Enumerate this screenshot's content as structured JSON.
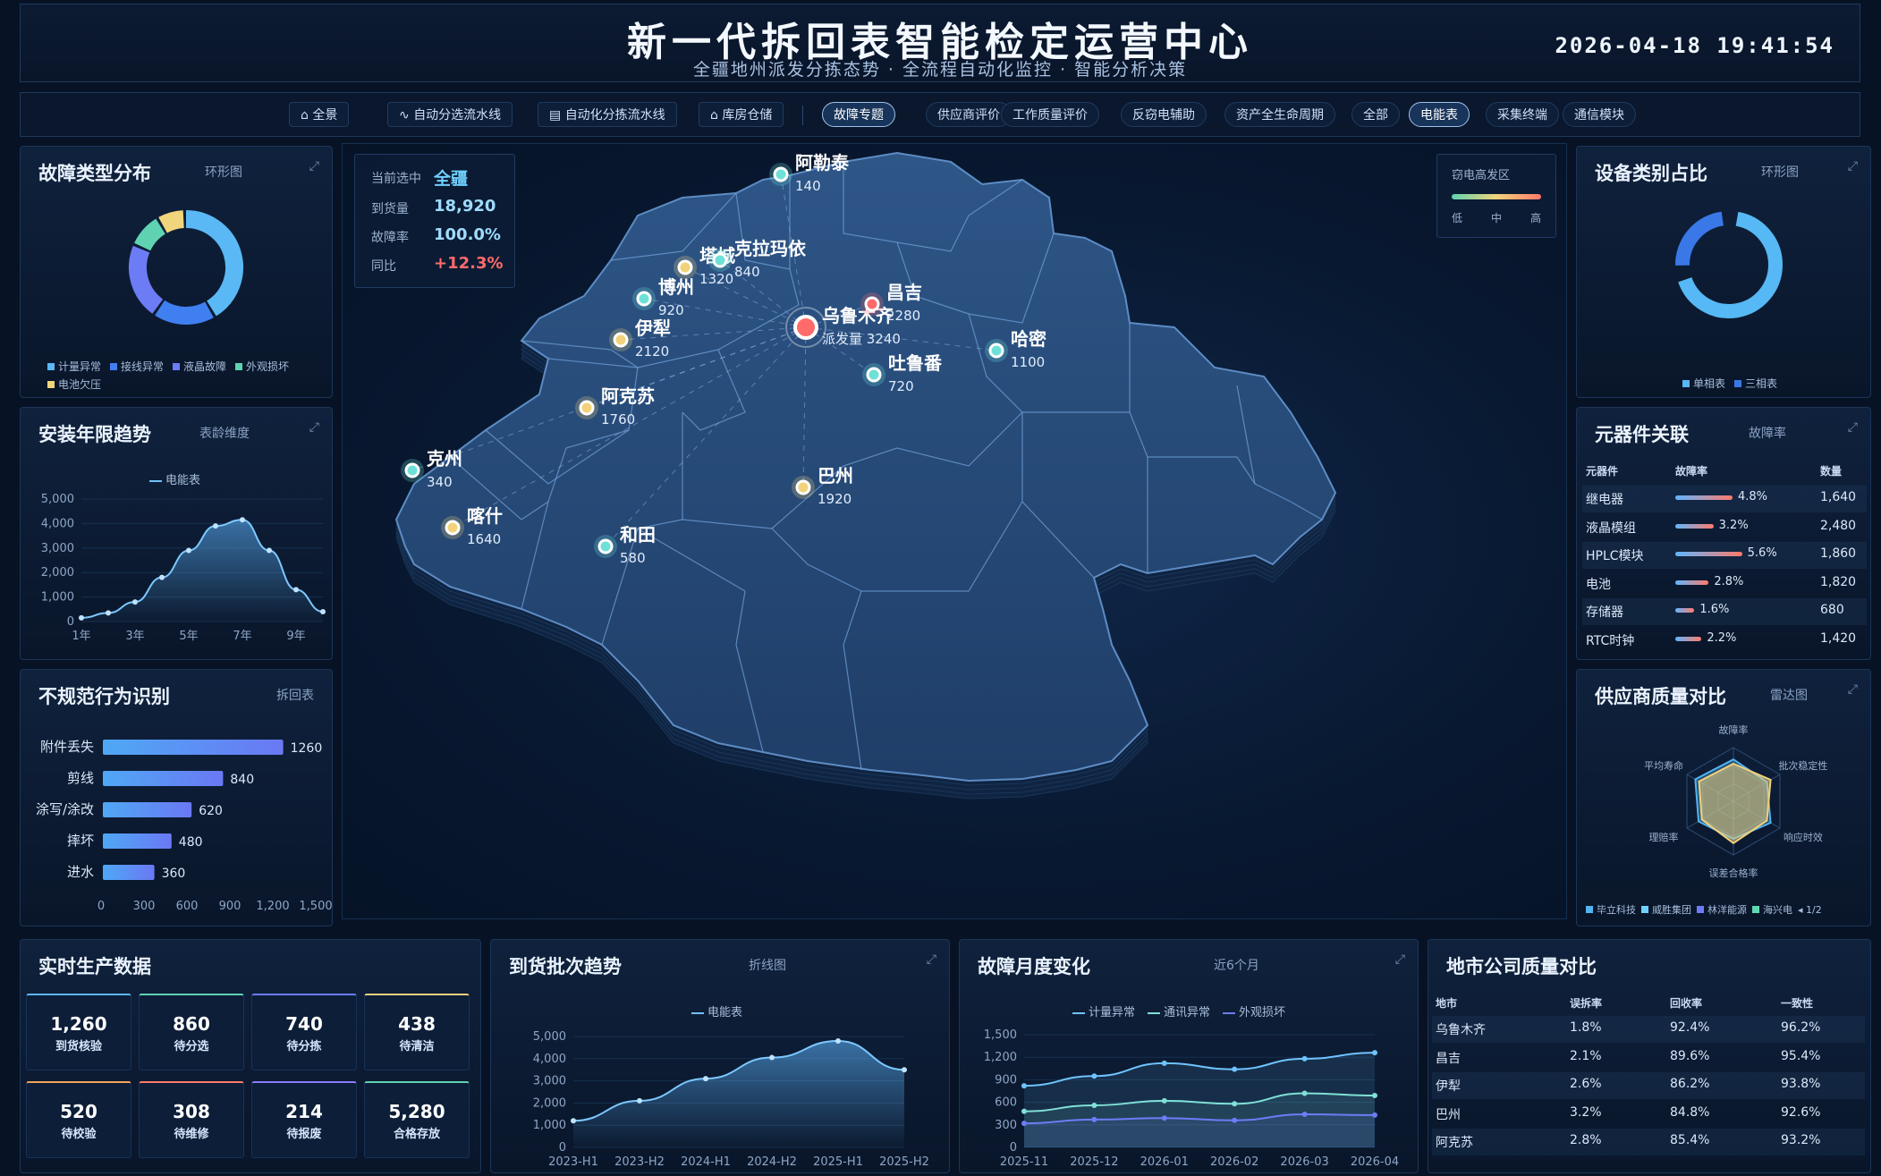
{
  "header": {
    "title": "新一代拆回表智能检定运营中心",
    "subtitle": "全疆地州派发分拣态势 · 全流程自动化监控 · 智能分析决策",
    "datetime": "2026-04-18 19:41:54"
  },
  "nav": {
    "main": [
      {
        "icon": "home-icon",
        "label": "全景"
      },
      {
        "icon": "wave-icon",
        "label": "自动分选流水线"
      },
      {
        "icon": "grid-icon",
        "label": "自动化分拣流水线"
      },
      {
        "icon": "warehouse-icon",
        "label": "库房仓储"
      }
    ],
    "topics": [
      "故障专题",
      "供应商评价",
      "工作质量评价",
      "反窃电辅助",
      "资产全生命周期"
    ],
    "filters": [
      "全部",
      "电能表",
      "采集终端",
      "通信模块"
    ],
    "active_topic": "故障专题",
    "active_filter": "电能表"
  },
  "colors": {
    "accent": "#5fb6ff",
    "bg": "#071224",
    "panel": "#0f2140",
    "red": "#ff6b6b",
    "yellow": "#f2d27a",
    "green": "#4fd6b3"
  },
  "fault_types": {
    "title": "故障类型分布",
    "sub": "环形图",
    "chart_data": {
      "type": "pie",
      "labels": [
        "计量异常",
        "接线异常",
        "液晶故障",
        "外观损坏",
        "电池欠压"
      ],
      "values": [
        42,
        18,
        22,
        10,
        8
      ],
      "colors": [
        "#5ab8f5",
        "#3f7ff0",
        "#6c7cf5",
        "#5fd3b1",
        "#f1d57c"
      ]
    },
    "legend": [
      "计量异常",
      "接线异常",
      "液晶故障",
      "外观损坏",
      "电池欠压"
    ]
  },
  "install_years": {
    "title": "安装年限趋势",
    "sub": "表龄维度",
    "legend": "电能表",
    "chart_data": {
      "type": "area",
      "x": [
        "1年",
        "2年",
        "3年",
        "4年",
        "5年",
        "6年",
        "7年",
        "8年",
        "9年",
        "10年"
      ],
      "y": [
        150,
        350,
        800,
        1800,
        2900,
        3900,
        4150,
        2900,
        1300,
        400
      ],
      "ylim": [
        0,
        5000
      ],
      "yticks": [
        "5,000",
        "4,000",
        "3,000",
        "2,000",
        "1,000",
        "0"
      ],
      "xticks": [
        "1年",
        "3年",
        "5年",
        "7年",
        "9年"
      ]
    }
  },
  "irregular": {
    "title": "不规范行为识别",
    "sub": "拆回表",
    "chart_data": {
      "type": "bar",
      "categories": [
        "附件丢失",
        "剪线",
        "涂写/涂改",
        "摔坏",
        "进水"
      ],
      "values": [
        1260,
        840,
        620,
        480,
        360
      ],
      "xlim": [
        0,
        1500
      ],
      "xticks": [
        "0",
        "300",
        "600",
        "900",
        "1,200",
        "1,500"
      ]
    }
  },
  "map_info": {
    "selected_label": "当前选中",
    "selected": "全疆",
    "rows": [
      {
        "label": "到货量",
        "value": "18,920",
        "color": "#9fdcff"
      },
      {
        "label": "故障率",
        "value": "100.0%",
        "color": "#9fdcff"
      },
      {
        "label": "同比",
        "value": "+12.3%",
        "color": "#ff6b6b"
      }
    ],
    "legend_title": "窃电高发区",
    "legend_scale": [
      "低",
      "中",
      "高"
    ]
  },
  "cities": [
    {
      "name": "阿勒泰",
      "value": "140",
      "type": "teal"
    },
    {
      "name": "塔城",
      "value": "1320",
      "type": "yellow"
    },
    {
      "name": "克拉玛依",
      "value": "840",
      "type": "teal"
    },
    {
      "name": "博州",
      "value": "920",
      "type": "teal"
    },
    {
      "name": "伊犁",
      "value": "2120",
      "type": "yellow"
    },
    {
      "name": "乌鲁木齐",
      "value": "派发量 3240",
      "type": "hub"
    },
    {
      "name": "昌吉",
      "value": "2280",
      "type": "red"
    },
    {
      "name": "哈密",
      "value": "1100",
      "type": "teal"
    },
    {
      "name": "吐鲁番",
      "value": "720",
      "type": "teal"
    },
    {
      "name": "阿克苏",
      "value": "1760",
      "type": "yellow"
    },
    {
      "name": "克州",
      "value": "340",
      "type": "teal"
    },
    {
      "name": "巴州",
      "value": "1920",
      "type": "yellow"
    },
    {
      "name": "喀什",
      "value": "1640",
      "type": "yellow"
    },
    {
      "name": "和田",
      "value": "580",
      "type": "teal"
    }
  ],
  "device_share": {
    "title": "设备类别占比",
    "sub": "环形图",
    "chart_data": {
      "type": "pie",
      "labels": [
        "单相表",
        "三相表"
      ],
      "values": [
        72,
        28
      ],
      "colors": [
        "#56b8f4",
        "#3a78e8"
      ]
    },
    "legend": [
      "单相表",
      "三相表"
    ]
  },
  "components": {
    "title": "元器件关联",
    "sub": "故障率",
    "headers": [
      "元器件",
      "故障率",
      "数量"
    ],
    "rows": [
      {
        "name": "继电器",
        "rate": "4.8%",
        "pct": 4.8,
        "qty": "1,640"
      },
      {
        "name": "液晶模组",
        "rate": "3.2%",
        "pct": 3.2,
        "qty": "2,480"
      },
      {
        "name": "HPLC模块",
        "rate": "5.6%",
        "pct": 5.6,
        "qty": "1,860"
      },
      {
        "name": "电池",
        "rate": "2.8%",
        "pct": 2.8,
        "qty": "1,820"
      },
      {
        "name": "存储器",
        "rate": "1.6%",
        "pct": 1.6,
        "qty": "680"
      },
      {
        "name": "RTC时钟",
        "rate": "2.2%",
        "pct": 2.2,
        "qty": "1,420"
      }
    ]
  },
  "supplier_radar": {
    "title": "供应商质量对比",
    "sub": "雷达图",
    "axes": [
      "故障率",
      "批次稳定性",
      "响应时效",
      "误差合格率",
      "理赔率",
      "平均寿命"
    ],
    "legend": [
      "毕立科技",
      "威胜集团",
      "林洋能源",
      "海兴电"
    ],
    "legend_colors": [
      "#53b4f2",
      "#6fd0ff",
      "#6d7cf6",
      "#5ed8b3"
    ],
    "page": "1/2",
    "chart_data": {
      "type": "radar",
      "series": [
        {
          "name": "毕立科技",
          "values": [
            0.78,
            0.72,
            0.8,
            0.7,
            0.75,
            0.82
          ]
        },
        {
          "name": "威胜集团",
          "values": [
            0.7,
            0.8,
            0.72,
            0.78,
            0.68,
            0.74
          ]
        }
      ]
    }
  },
  "realtime": {
    "title": "实时生产数据",
    "cards": [
      {
        "value": "1,260",
        "label": "到货核验"
      },
      {
        "value": "860",
        "label": "待分选"
      },
      {
        "value": "740",
        "label": "待分拣"
      },
      {
        "value": "438",
        "label": "待清洁"
      },
      {
        "value": "520",
        "label": "待校验"
      },
      {
        "value": "308",
        "label": "待维修"
      },
      {
        "value": "214",
        "label": "待报废"
      },
      {
        "value": "5,280",
        "label": "合格存放"
      }
    ]
  },
  "arrival_trend": {
    "title": "到货批次趋势",
    "sub": "折线图",
    "legend": "电能表",
    "chart_data": {
      "type": "area",
      "x": [
        "2023-H1",
        "2023-H2",
        "2024-H1",
        "2024-H2",
        "2025-H1",
        "2025-H2"
      ],
      "y": [
        1200,
        2100,
        3100,
        4050,
        4800,
        3500
      ],
      "ylim": [
        0,
        5000
      ],
      "yticks": [
        "5,000",
        "4,000",
        "3,000",
        "2,000",
        "1,000",
        "0"
      ]
    }
  },
  "fault_monthly": {
    "title": "故障月度变化",
    "sub": "近6个月",
    "legend": [
      "计量异常",
      "通讯异常",
      "外观损坏"
    ],
    "chart_data": {
      "type": "line",
      "x": [
        "2025-11",
        "2025-12",
        "2026-01",
        "2026-02",
        "2026-03",
        "2026-04"
      ],
      "series": [
        {
          "name": "计量异常",
          "values": [
            820,
            950,
            1120,
            1040,
            1180,
            1260
          ],
          "color": "#6fc3ff"
        },
        {
          "name": "通讯异常",
          "values": [
            480,
            560,
            620,
            580,
            720,
            690
          ],
          "color": "#7fe0d6"
        },
        {
          "name": "外观损坏",
          "values": [
            320,
            370,
            390,
            360,
            440,
            430
          ],
          "color": "#6d7cf6"
        }
      ],
      "ylim": [
        0,
        1500
      ],
      "yticks": [
        "1,500",
        "1,200",
        "900",
        "600",
        "300",
        "0"
      ]
    }
  },
  "city_quality": {
    "title": "地市公司质量对比",
    "headers": [
      "地市",
      "误拆率",
      "回收率",
      "一致性"
    ],
    "rows": [
      [
        "乌鲁木齐",
        "1.8%",
        "92.4%",
        "96.2%"
      ],
      [
        "昌吉",
        "2.1%",
        "89.6%",
        "95.4%"
      ],
      [
        "伊犁",
        "2.6%",
        "86.2%",
        "93.8%"
      ],
      [
        "巴州",
        "3.2%",
        "84.8%",
        "92.6%"
      ],
      [
        "阿克苏",
        "2.8%",
        "85.4%",
        "93.2%"
      ]
    ]
  }
}
